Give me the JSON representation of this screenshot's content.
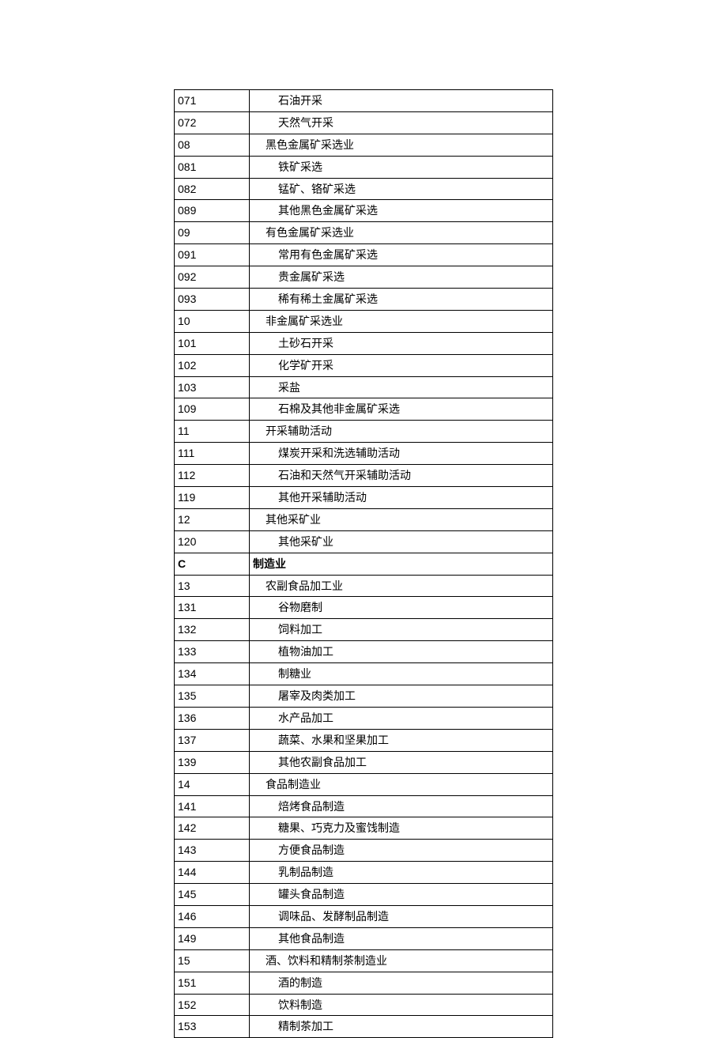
{
  "rows": [
    {
      "code": "071",
      "name": "石油开采",
      "level": 2
    },
    {
      "code": "072",
      "name": "天然气开采",
      "level": 2
    },
    {
      "code": "08",
      "name": "黑色金属矿采选业",
      "level": 1
    },
    {
      "code": "081",
      "name": "铁矿采选",
      "level": 2
    },
    {
      "code": "082",
      "name": "锰矿、铬矿采选",
      "level": 2
    },
    {
      "code": "089",
      "name": "其他黑色金属矿采选",
      "level": 2
    },
    {
      "code": "09",
      "name": "有色金属矿采选业",
      "level": 1
    },
    {
      "code": "091",
      "name": "常用有色金属矿采选",
      "level": 2
    },
    {
      "code": "092",
      "name": "贵金属矿采选",
      "level": 2
    },
    {
      "code": "093",
      "name": "稀有稀土金属矿采选",
      "level": 2
    },
    {
      "code": "10",
      "name": "非金属矿采选业",
      "level": 1
    },
    {
      "code": "101",
      "name": "土砂石开采",
      "level": 2
    },
    {
      "code": "102",
      "name": "化学矿开采",
      "level": 2
    },
    {
      "code": "103",
      "name": "采盐",
      "level": 2
    },
    {
      "code": "109",
      "name": "石棉及其他非金属矿采选",
      "level": 2
    },
    {
      "code": "11",
      "name": "开采辅助活动",
      "level": 1
    },
    {
      "code": "111",
      "name": "煤炭开采和洗选辅助活动",
      "level": 2
    },
    {
      "code": "112",
      "name": "石油和天然气开采辅助活动",
      "level": 2
    },
    {
      "code": "119",
      "name": "其他开采辅助活动",
      "level": 2
    },
    {
      "code": "12",
      "name": "其他采矿业",
      "level": 1
    },
    {
      "code": "120",
      "name": "其他采矿业",
      "level": 2
    },
    {
      "code": "C",
      "name": "制造业",
      "level": 0
    },
    {
      "code": "13",
      "name": "农副食品加工业",
      "level": 1
    },
    {
      "code": "131",
      "name": "谷物磨制",
      "level": 2
    },
    {
      "code": "132",
      "name": "饲料加工",
      "level": 2
    },
    {
      "code": "133",
      "name": "植物油加工",
      "level": 2
    },
    {
      "code": "134",
      "name": "制糖业",
      "level": 2
    },
    {
      "code": "135",
      "name": "屠宰及肉类加工",
      "level": 2
    },
    {
      "code": "136",
      "name": "水产品加工",
      "level": 2
    },
    {
      "code": "137",
      "name": "蔬菜、水果和坚果加工",
      "level": 2
    },
    {
      "code": "139",
      "name": "其他农副食品加工",
      "level": 2
    },
    {
      "code": "14",
      "name": "食品制造业",
      "level": 1
    },
    {
      "code": "141",
      "name": "焙烤食品制造",
      "level": 2
    },
    {
      "code": "142",
      "name": "糖果、巧克力及蜜饯制造",
      "level": 2
    },
    {
      "code": "143",
      "name": "方便食品制造",
      "level": 2
    },
    {
      "code": "144",
      "name": "乳制品制造",
      "level": 2
    },
    {
      "code": "145",
      "name": "罐头食品制造",
      "level": 2
    },
    {
      "code": "146",
      "name": "调味品、发酵制品制造",
      "level": 2
    },
    {
      "code": "149",
      "name": "其他食品制造",
      "level": 2
    },
    {
      "code": "15",
      "name": "酒、饮料和精制茶制造业",
      "level": 1
    },
    {
      "code": "151",
      "name": "酒的制造",
      "level": 2
    },
    {
      "code": "152",
      "name": "饮料制造",
      "level": 2
    },
    {
      "code": "153",
      "name": "精制茶加工",
      "level": 2
    }
  ]
}
